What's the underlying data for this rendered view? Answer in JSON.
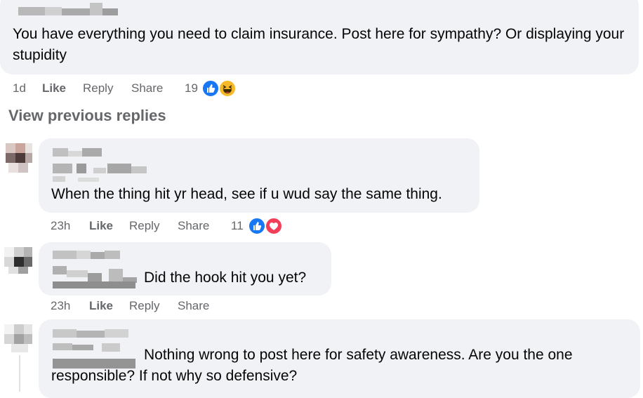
{
  "comments": [
    {
      "text": "You have everything you need to claim insurance. Post here for sympathy? Or displaying your stupidity",
      "time": "1d",
      "like": "Like",
      "reply": "Reply",
      "share": "Share",
      "reaction_count": "19",
      "reactions": [
        "like-icon",
        "haha-icon"
      ]
    },
    {
      "text": "When the thing hit yr head, see if u wud say the same thing.",
      "time": "23h",
      "like": "Like",
      "reply": "Reply",
      "share": "Share",
      "reaction_count": "11",
      "reactions": [
        "like-icon",
        "love-icon"
      ]
    },
    {
      "text": "Did the hook hit you yet?",
      "time": "23h",
      "like": "Like",
      "reply": "Reply",
      "share": "Share"
    },
    {
      "text_line1": "Nothing wrong to post here for safety awareness. Are you the one",
      "text_line2": "responsible? If not why so defensive?"
    }
  ],
  "view_previous": "View previous replies",
  "colors": {
    "bubble": "#f0f2f5",
    "meta": "#65676b",
    "like_blue": "#1877f2",
    "love_red": "#f33e58",
    "haha_yellow": "#f7b928"
  }
}
